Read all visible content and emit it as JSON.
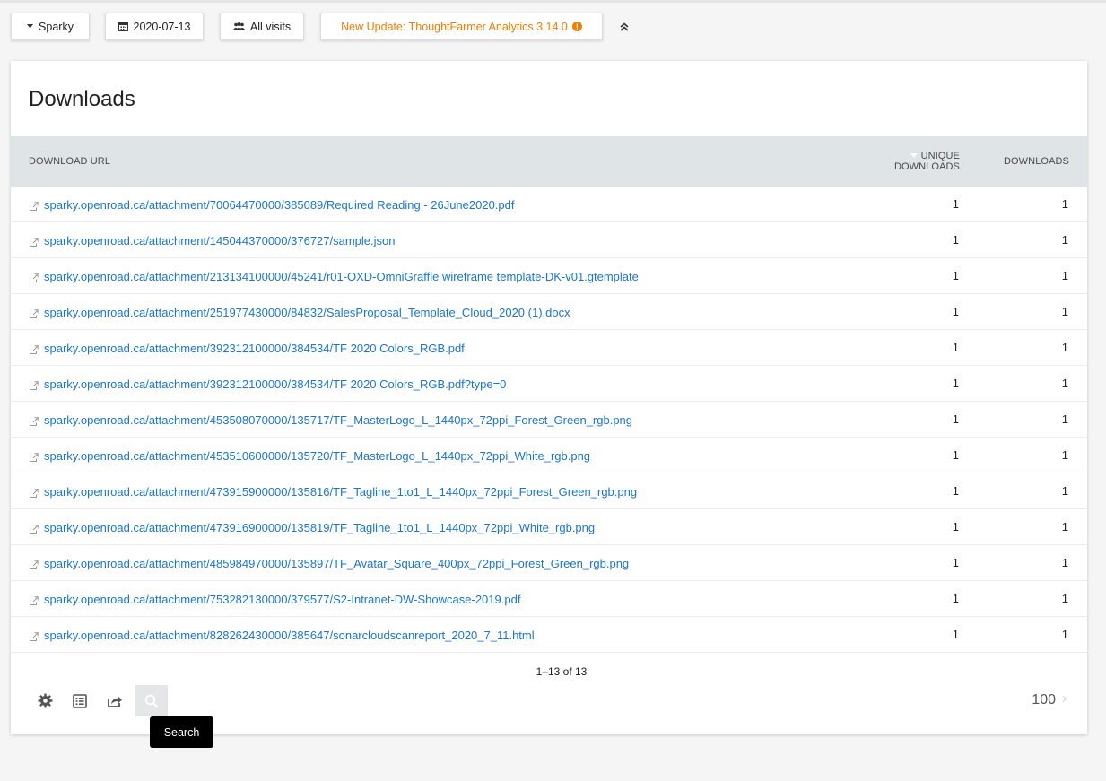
{
  "topbar": {
    "site_label": "Sparky",
    "date_label": "2020-07-13",
    "segment_label": "All visits",
    "update_label": "New Update: ThoughtFarmer Analytics 3.14.0",
    "update_color": "#f57c00"
  },
  "report": {
    "title": "Downloads",
    "columns": {
      "url": "DOWNLOAD URL",
      "unique_line1": "UNIQUE",
      "unique_line2": "DOWNLOADS",
      "downloads": "DOWNLOADS"
    },
    "rows": [
      {
        "url": "sparky.openroad.ca/attachment/70064470000/385089/Required Reading - 26June2020.pdf",
        "unique": "1",
        "downloads": "1"
      },
      {
        "url": "sparky.openroad.ca/attachment/145044370000/376727/sample.json",
        "unique": "1",
        "downloads": "1"
      },
      {
        "url": "sparky.openroad.ca/attachment/213134100000/45241/r01-OXD-OmniGraffle wireframe template-DK-v01.gtemplate",
        "unique": "1",
        "downloads": "1"
      },
      {
        "url": "sparky.openroad.ca/attachment/251977430000/84832/SalesProposal_Template_Cloud_2020 (1).docx",
        "unique": "1",
        "downloads": "1"
      },
      {
        "url": "sparky.openroad.ca/attachment/392312100000/384534/TF 2020 Colors_RGB.pdf",
        "unique": "1",
        "downloads": "1"
      },
      {
        "url": "sparky.openroad.ca/attachment/392312100000/384534/TF 2020 Colors_RGB.pdf?type=0",
        "unique": "1",
        "downloads": "1"
      },
      {
        "url": "sparky.openroad.ca/attachment/453508070000/135717/TF_MasterLogo_L_1440px_72ppi_Forest_Green_rgb.png",
        "unique": "1",
        "downloads": "1"
      },
      {
        "url": "sparky.openroad.ca/attachment/453510600000/135720/TF_MasterLogo_L_1440px_72ppi_White_rgb.png",
        "unique": "1",
        "downloads": "1"
      },
      {
        "url": "sparky.openroad.ca/attachment/473915900000/135816/TF_Tagline_1to1_L_1440px_72ppi_Forest_Green_rgb.png",
        "unique": "1",
        "downloads": "1"
      },
      {
        "url": "sparky.openroad.ca/attachment/473916900000/135819/TF_Tagline_1to1_L_1440px_72ppi_White_rgb.png",
        "unique": "1",
        "downloads": "1"
      },
      {
        "url": "sparky.openroad.ca/attachment/485984970000/135897/TF_Avatar_Square_400px_72ppi_Forest_Green_rgb.png",
        "unique": "1",
        "downloads": "1"
      },
      {
        "url": "sparky.openroad.ca/attachment/753282130000/379577/S2-Intranet-DW-Showcase-2019.pdf",
        "unique": "1",
        "downloads": "1"
      },
      {
        "url": "sparky.openroad.ca/attachment/828262430000/385647/sonarcloudscanreport_2020_7_11.html",
        "unique": "1",
        "downloads": "1"
      }
    ],
    "pagination": "1–13 of 13",
    "limit": "100",
    "tooltip": "Search",
    "link_color": "#1976d2"
  }
}
